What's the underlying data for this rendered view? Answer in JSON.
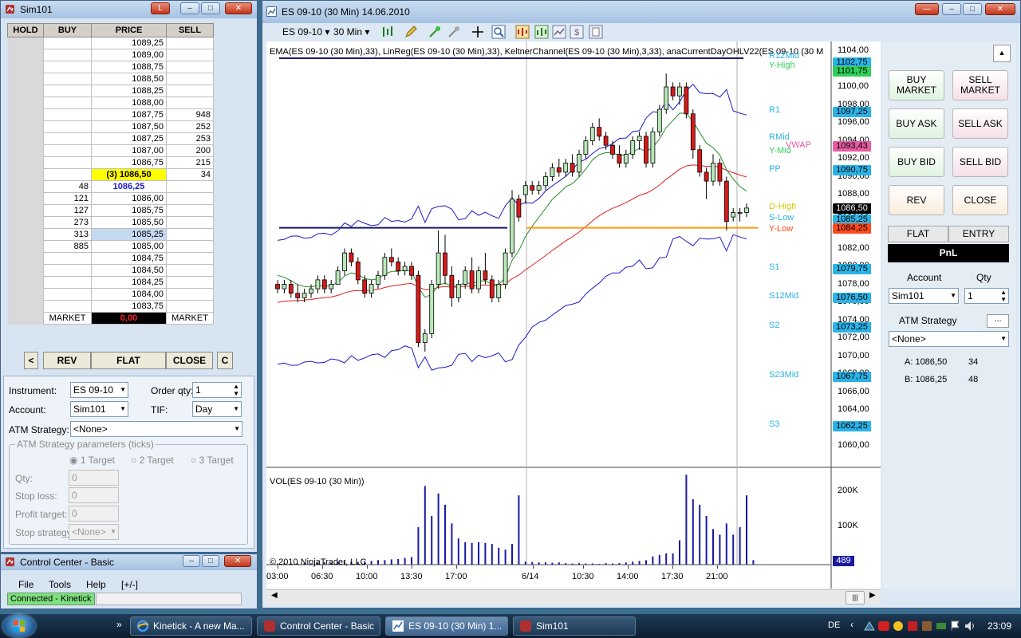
{
  "dom_window": {
    "title": "Sim101",
    "headers": [
      "HOLD",
      "BUY",
      "PRICE",
      "SELL"
    ],
    "rows": [
      {
        "buy": "",
        "price": "1089,25",
        "sell": ""
      },
      {
        "buy": "",
        "price": "1089,00",
        "sell": ""
      },
      {
        "buy": "",
        "price": "1088,75",
        "sell": ""
      },
      {
        "buy": "",
        "price": "1088,50",
        "sell": ""
      },
      {
        "buy": "",
        "price": "1088,25",
        "sell": ""
      },
      {
        "buy": "",
        "price": "1088,00",
        "sell": ""
      },
      {
        "buy": "",
        "price": "1087,75",
        "sell": "948"
      },
      {
        "buy": "",
        "price": "1087,50",
        "sell": "252"
      },
      {
        "buy": "",
        "price": "1087,25",
        "sell": "253"
      },
      {
        "buy": "",
        "price": "1087,00",
        "sell": "200"
      },
      {
        "buy": "",
        "price": "1086,75",
        "sell": "215"
      },
      {
        "buy": "",
        "price": "(3) 1086,50",
        "sell": "34",
        "hl": "ask"
      },
      {
        "buy": "48",
        "price": "1086,25",
        "sell": "",
        "hl": "last"
      },
      {
        "buy": "121",
        "price": "1086,00",
        "sell": ""
      },
      {
        "buy": "127",
        "price": "1085,75",
        "sell": ""
      },
      {
        "buy": "273",
        "price": "1085,50",
        "sell": ""
      },
      {
        "buy": "313",
        "price": "1085,25",
        "sell": "",
        "hl": "bid"
      },
      {
        "buy": "885",
        "price": "1085,00",
        "sell": ""
      },
      {
        "buy": "",
        "price": "1084,75",
        "sell": ""
      },
      {
        "buy": "",
        "price": "1084,50",
        "sell": ""
      },
      {
        "buy": "",
        "price": "1084,25",
        "sell": ""
      },
      {
        "buy": "",
        "price": "1084,00",
        "sell": ""
      },
      {
        "buy": "",
        "price": "1083,75",
        "sell": ""
      }
    ],
    "market_left": "MARKET",
    "pnl_value": "0,00",
    "market_right": "MARKET",
    "btn_left": "<",
    "btn_rev": "REV",
    "btn_flat": "FLAT",
    "btn_close": "CLOSE",
    "btn_c": "C",
    "instrument_label": "Instrument:",
    "instrument_value": "ES 09-10",
    "orderqty_label": "Order qty:",
    "orderqty_value": "1",
    "account_label": "Account:",
    "account_value": "Sim101",
    "tif_label": "TIF:",
    "tif_value": "Day",
    "atm_label": "ATM Strategy:",
    "atm_value": "<None>",
    "atm_group": "ATM Strategy parameters (ticks)",
    "targets": [
      "1 Target",
      "2 Target",
      "3 Target"
    ],
    "qty_label": "Qty:",
    "qty_value": "0",
    "stoploss_label": "Stop loss:",
    "stoploss_value": "0",
    "profit_label": "Profit target:",
    "profit_value": "0",
    "stopstrat_label": "Stop strategy:",
    "stopstrat_value": "<None>"
  },
  "control_center": {
    "title": "Control Center - Basic",
    "menu": [
      "File",
      "Tools",
      "Help",
      "[+/-]"
    ],
    "status": "Connected - Kinetick"
  },
  "chart_window": {
    "title": "ES 09-10 (30 Min)  14.06.2010",
    "instrument": "ES 09-10",
    "interval": "30 Min",
    "indicators": "EMA(ES 09-10 (30 Min),33), LinReg(ES 09-10 (30 Min),33), KeltnerChannel(ES 09-10 (30 Min),3,33), anaCurrentDayOHLV22(ES 09-10 (30 M",
    "volume_label": "VOL(ES 09-10 (30 Min))",
    "copyright": "© 2010 NinjaTrader, LLC",
    "price_ticks": [
      "1104,00",
      "1102,00",
      "1100,00",
      "1098,00",
      "1096,00",
      "1094,00",
      "1092,00",
      "1090,00",
      "1088,00",
      "1086,00",
      "1084,00",
      "1082,00",
      "1080,00",
      "1078,00",
      "1076,00",
      "1074,00",
      "1072,00",
      "1070,00",
      "1068,00",
      "1066,00",
      "1064,00",
      "1062,00",
      "1060,00"
    ],
    "price_tags": [
      {
        "text": "1102,75",
        "color": "#2bb3e8"
      },
      {
        "text": "1101,75",
        "color": "#2fd05a"
      },
      {
        "text": "1097,25",
        "color": "#2bb3e8"
      },
      {
        "text": "1093,43",
        "color": "#e85ca0"
      },
      {
        "text": "1090,75",
        "color": "#2bb3e8"
      },
      {
        "text": "1086,50",
        "color": "#000000"
      },
      {
        "text": "1085,25",
        "color": "#2bb3e8"
      },
      {
        "text": "1084,25",
        "color": "#ff4a1c"
      },
      {
        "text": "1079,75",
        "color": "#2bb3e8"
      },
      {
        "text": "1076,50",
        "color": "#2bb3e8"
      },
      {
        "text": "1073,25",
        "color": "#2bb3e8"
      },
      {
        "text": "1067,75",
        "color": "#2bb3e8"
      },
      {
        "text": "1062,25",
        "color": "#2bb3e8"
      }
    ],
    "pivot_labels": [
      {
        "text": "R12Mid",
        "color": "#2bb3e8"
      },
      {
        "text": "Y-High",
        "color": "#2fd05a"
      },
      {
        "text": "R1",
        "color": "#2bb3e8"
      },
      {
        "text": "RMid",
        "color": "#2bb3e8"
      },
      {
        "text": "VWAP",
        "color": "#e85ca0"
      },
      {
        "text": "Y-Mid",
        "color": "#2fd05a"
      },
      {
        "text": "PP",
        "color": "#2bb3e8"
      },
      {
        "text": "D-High",
        "color": "#cccc00"
      },
      {
        "text": "S-Low",
        "color": "#2bb3e8"
      },
      {
        "text": "Y-Low",
        "color": "#ff4a1c"
      },
      {
        "text": "S1",
        "color": "#2bb3e8"
      },
      {
        "text": "S12Mid",
        "color": "#2bb3e8"
      },
      {
        "text": "S2",
        "color": "#2bb3e8"
      },
      {
        "text": "S23Mid",
        "color": "#2bb3e8"
      },
      {
        "text": "S3",
        "color": "#2bb3e8"
      }
    ],
    "volume_ticks": [
      "200K",
      "100K"
    ],
    "volume_last": "489",
    "time_ticks": [
      "03:00",
      "06:30",
      "10:00",
      "13:30",
      "17:00",
      "6/14",
      "10:30",
      "14:00",
      "17:30",
      "21:00"
    ]
  },
  "chart_data": {
    "type": "candlestick",
    "ylim": [
      1059,
      1105
    ],
    "candles": [
      [
        1078.0,
        1078.5,
        1077.0,
        1077.5
      ],
      [
        1077.5,
        1078.5,
        1077.0,
        1078.0
      ],
      [
        1078.0,
        1078.5,
        1076.5,
        1077.0
      ],
      [
        1077.0,
        1078.0,
        1076.0,
        1076.5
      ],
      [
        1076.5,
        1077.5,
        1076.0,
        1077.0
      ],
      [
        1077.0,
        1078.0,
        1076.5,
        1077.5
      ],
      [
        1077.5,
        1079.0,
        1077.0,
        1078.5
      ],
      [
        1078.5,
        1079.0,
        1077.0,
        1077.5
      ],
      [
        1077.5,
        1078.5,
        1077.0,
        1078.0
      ],
      [
        1078.0,
        1080.0,
        1078.0,
        1079.5
      ],
      [
        1079.5,
        1082.0,
        1079.0,
        1081.5
      ],
      [
        1081.5,
        1082.0,
        1080.0,
        1080.5
      ],
      [
        1080.5,
        1081.0,
        1078.0,
        1078.5
      ],
      [
        1078.5,
        1079.0,
        1076.5,
        1077.0
      ],
      [
        1077.0,
        1078.5,
        1076.5,
        1078.0
      ],
      [
        1078.0,
        1079.5,
        1077.5,
        1079.0
      ],
      [
        1079.0,
        1081.5,
        1078.5,
        1081.0
      ],
      [
        1081.0,
        1082.0,
        1080.0,
        1080.5
      ],
      [
        1080.5,
        1081.0,
        1079.0,
        1079.5
      ],
      [
        1079.5,
        1080.5,
        1079.0,
        1080.0
      ],
      [
        1080.0,
        1080.5,
        1078.5,
        1079.0
      ],
      [
        1079.0,
        1079.5,
        1071.0,
        1071.5
      ],
      [
        1071.5,
        1073.0,
        1070.5,
        1072.5
      ],
      [
        1072.5,
        1078.5,
        1072.0,
        1078.0
      ],
      [
        1078.0,
        1084.0,
        1077.5,
        1081.5
      ],
      [
        1081.5,
        1083.5,
        1078.0,
        1079.0
      ],
      [
        1079.0,
        1080.0,
        1075.5,
        1076.5
      ],
      [
        1076.5,
        1078.5,
        1076.0,
        1078.0
      ],
      [
        1078.0,
        1080.0,
        1077.5,
        1079.5
      ],
      [
        1079.5,
        1081.0,
        1077.0,
        1077.5
      ],
      [
        1077.5,
        1080.0,
        1077.0,
        1079.5
      ],
      [
        1079.5,
        1081.5,
        1078.0,
        1078.5
      ],
      [
        1078.5,
        1079.0,
        1076.0,
        1076.5
      ],
      [
        1076.5,
        1078.5,
        1076.0,
        1078.0
      ],
      [
        1078.0,
        1082.0,
        1077.5,
        1081.5
      ],
      [
        1081.5,
        1088.5,
        1081.0,
        1087.5
      ],
      [
        1087.5,
        1088.0,
        1085.0,
        1085.5
      ],
      [
        1088.0,
        1089.5,
        1087.0,
        1089.0
      ],
      [
        1089.0,
        1089.5,
        1088.0,
        1088.5
      ],
      [
        1088.5,
        1089.5,
        1088.0,
        1089.0
      ],
      [
        1089.0,
        1090.5,
        1088.5,
        1090.0
      ],
      [
        1090.0,
        1091.5,
        1089.5,
        1091.0
      ],
      [
        1091.0,
        1092.0,
        1090.0,
        1090.5
      ],
      [
        1090.5,
        1092.0,
        1090.0,
        1091.5
      ],
      [
        1091.5,
        1092.5,
        1090.0,
        1090.5
      ],
      [
        1090.5,
        1093.0,
        1090.0,
        1092.5
      ],
      [
        1092.5,
        1094.5,
        1092.0,
        1094.0
      ],
      [
        1094.0,
        1096.0,
        1093.5,
        1095.5
      ],
      [
        1095.5,
        1096.5,
        1094.0,
        1094.5
      ],
      [
        1094.5,
        1095.0,
        1093.0,
        1093.5
      ],
      [
        1093.5,
        1094.0,
        1092.0,
        1092.5
      ],
      [
        1092.5,
        1093.5,
        1091.0,
        1091.5
      ],
      [
        1091.5,
        1093.0,
        1091.0,
        1092.5
      ],
      [
        1092.5,
        1094.5,
        1092.0,
        1094.0
      ],
      [
        1094.0,
        1095.0,
        1093.0,
        1094.5
      ],
      [
        1094.5,
        1095.0,
        1091.0,
        1091.5
      ],
      [
        1091.5,
        1095.5,
        1091.0,
        1095.0
      ],
      [
        1095.0,
        1098.0,
        1094.5,
        1097.5
      ],
      [
        1097.5,
        1101.5,
        1097.0,
        1100.0
      ],
      [
        1100.0,
        1100.5,
        1098.5,
        1099.0
      ],
      [
        1099.0,
        1100.5,
        1098.0,
        1100.0
      ],
      [
        1100.0,
        1100.5,
        1096.5,
        1097.0
      ],
      [
        1097.0,
        1097.5,
        1092.0,
        1093.0
      ],
      [
        1093.0,
        1093.5,
        1090.0,
        1090.5
      ],
      [
        1090.5,
        1091.0,
        1087.5,
        1089.5
      ],
      [
        1089.5,
        1092.5,
        1089.0,
        1091.5
      ],
      [
        1091.5,
        1092.0,
        1089.0,
        1089.5
      ],
      [
        1089.5,
        1090.0,
        1084.0,
        1085.0
      ],
      [
        1085.5,
        1086.5,
        1085.0,
        1086.0
      ],
      [
        1086.0,
        1086.5,
        1085.0,
        1086.0
      ],
      [
        1086.0,
        1087.0,
        1085.5,
        1086.5
      ]
    ],
    "volume_ylim": [
      0,
      230000
    ],
    "volume": [
      3000,
      4000,
      3000,
      3000,
      4000,
      3000,
      5000,
      6000,
      5000,
      7000,
      8000,
      8000,
      7000,
      9000,
      10000,
      12000,
      12000,
      14000,
      15000,
      18000,
      20000,
      100000,
      210000,
      130000,
      190000,
      160000,
      110000,
      70000,
      60000,
      58000,
      60000,
      58000,
      55000,
      45000,
      40000,
      55000,
      185000,
      8000,
      7000,
      6000,
      6000,
      5000,
      6000,
      4000,
      3000,
      4000,
      3000,
      3000,
      2000,
      4000,
      3000,
      4000,
      6000,
      8000,
      10000,
      12000,
      22000,
      26000,
      30000,
      30000,
      65000,
      240000,
      175000,
      160000,
      130000,
      95000,
      80000,
      110000,
      80000,
      100000,
      185000,
      12000
    ]
  },
  "order_panel": {
    "buttons": [
      "BUY MARKET",
      "SELL MARKET",
      "BUY ASK",
      "SELL ASK",
      "BUY BID",
      "SELL BID",
      "REV",
      "CLOSE"
    ],
    "flat": "FLAT",
    "entry": "ENTRY",
    "pnl": "PnL",
    "account_label": "Account",
    "qty_label": "Qty",
    "account_value": "Sim101",
    "qty_value": "1",
    "atm_label": "ATM Strategy",
    "atm_btn": "...",
    "atm_value": "<None>",
    "ask_label": "A: 1086,50",
    "ask_qty": "34",
    "bid_label": "B: 1086,25",
    "bid_qty": "48"
  },
  "taskbar": {
    "items": [
      "Kinetick - A new Ma...",
      "Control Center - Basic",
      "ES 09-10 (30 Min)  1...",
      "Sim101"
    ],
    "lang": "DE",
    "clock": "23:09"
  }
}
